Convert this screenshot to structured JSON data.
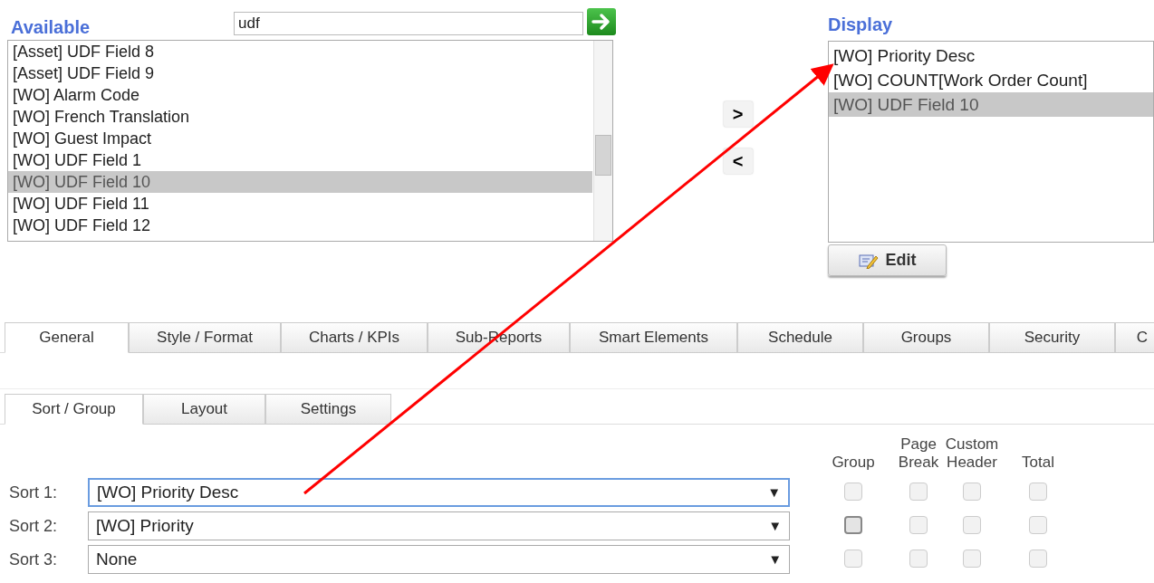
{
  "available": {
    "title": "Available",
    "search": {
      "value": "udf"
    },
    "items": [
      {
        "label": "[Asset] UDF Field 8",
        "selected": false
      },
      {
        "label": "[Asset] UDF Field 9",
        "selected": false
      },
      {
        "label": "[WO] Alarm Code",
        "selected": false
      },
      {
        "label": "[WO] French Translation",
        "selected": false
      },
      {
        "label": "[WO] Guest Impact",
        "selected": false
      },
      {
        "label": "[WO] UDF Field 1",
        "selected": false
      },
      {
        "label": "[WO] UDF Field 10",
        "selected": true
      },
      {
        "label": "[WO] UDF Field 11",
        "selected": false
      },
      {
        "label": "[WO] UDF Field 12",
        "selected": false
      }
    ]
  },
  "move_buttons": [
    {
      "label": ">"
    },
    {
      "label": "<"
    }
  ],
  "display": {
    "title": "Display",
    "items": [
      {
        "label": "[WO] Priority Desc",
        "selected": false
      },
      {
        "label": "[WO] COUNT[Work Order Count]",
        "selected": false
      },
      {
        "label": "[WO] UDF Field 10",
        "selected": true
      }
    ],
    "edit_button": "Edit"
  },
  "tabs": [
    {
      "label": "General",
      "selected": true
    },
    {
      "label": "Style / Format",
      "selected": false
    },
    {
      "label": "Charts / KPIs",
      "selected": false
    },
    {
      "label": "Sub-Reports",
      "selected": false
    },
    {
      "label": "Smart Elements",
      "selected": false
    },
    {
      "label": "Schedule",
      "selected": false
    },
    {
      "label": "Groups",
      "selected": false
    },
    {
      "label": "Security",
      "selected": false
    },
    {
      "label": "C",
      "selected": false
    }
  ],
  "sub_tabs": [
    {
      "label": "Sort / Group",
      "selected": true
    },
    {
      "label": "Layout",
      "selected": false
    },
    {
      "label": "Settings",
      "selected": false
    }
  ],
  "columns": [
    [
      "Group"
    ],
    [
      "Page",
      "Break"
    ],
    [
      "Custom",
      "Header"
    ],
    [
      "Total"
    ]
  ],
  "sorts": [
    {
      "label": "Sort 1:",
      "value": "[WO] Priority Desc",
      "focused": true,
      "checks": [
        {
          "checked": false,
          "focused": false
        },
        {
          "checked": false,
          "focused": false
        },
        {
          "checked": false,
          "focused": false
        },
        {
          "checked": false,
          "focused": false
        }
      ]
    },
    {
      "label": "Sort 2:",
      "value": "[WO] Priority",
      "focused": false,
      "checks": [
        {
          "checked": false,
          "focused": true
        },
        {
          "checked": false,
          "focused": false
        },
        {
          "checked": false,
          "focused": false
        },
        {
          "checked": false,
          "focused": false
        }
      ]
    },
    {
      "label": "Sort 3:",
      "value": "None",
      "focused": false,
      "checks": [
        {
          "checked": false,
          "focused": false
        },
        {
          "checked": false,
          "focused": false
        },
        {
          "checked": false,
          "focused": false
        },
        {
          "checked": false,
          "focused": false
        }
      ]
    }
  ],
  "dropdown_symbol": "▼"
}
